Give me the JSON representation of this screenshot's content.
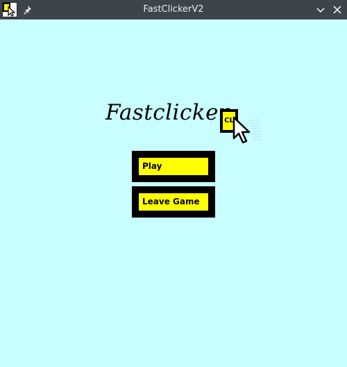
{
  "window": {
    "title": "FastClickerV2"
  },
  "titlebar": {
    "app_icon": "fastclicker-app-icon",
    "pin_icon": "pin-icon",
    "minimize_icon": "chevron-down-icon",
    "close_icon": "close-icon"
  },
  "logo": {
    "text": "Fastclicker",
    "badge_text": "CL",
    "cursor_icon": "mouse-pointer-icon"
  },
  "menu": {
    "play_label": "Play",
    "leave_label": "Leave Game"
  },
  "colors": {
    "background": "#c8feff",
    "button_face": "#ffff00",
    "button_border": "#000000",
    "titlebar": "#3f434a"
  }
}
